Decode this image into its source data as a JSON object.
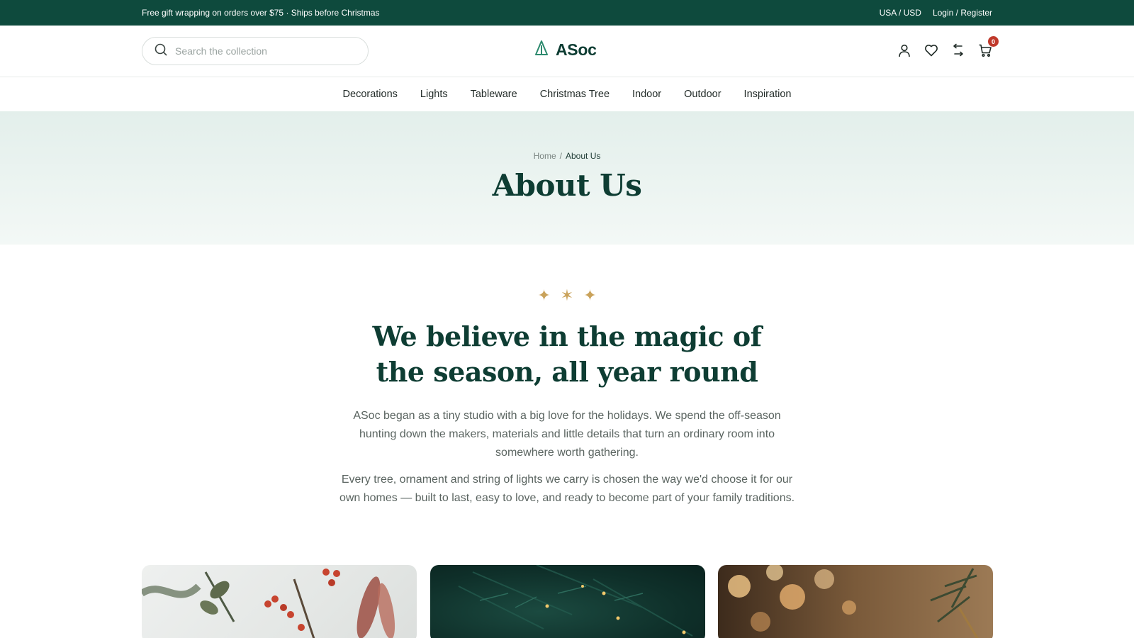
{
  "topbar": {
    "promo": "Free gift wrapping on orders over $75 · Ships before Christmas",
    "currency": "USA / USD",
    "account": "Login / Register",
    "bg_color": "#0e4a3d"
  },
  "header": {
    "search_placeholder": "Search the collection",
    "search_icon": "search-icon",
    "logo_text": "ASoc",
    "logo_icon": "tree-icon",
    "icons": [
      "user-icon",
      "heart-icon",
      "compare-icon",
      "cart-icon"
    ],
    "cart_count": "0"
  },
  "nav": {
    "items": [
      "Decorations",
      "Lights",
      "Tableware",
      "Christmas Tree",
      "Indoor",
      "Outdoor",
      "Inspiration"
    ]
  },
  "page": {
    "breadcrumb_home": "Home",
    "breadcrumb_sep": "/",
    "breadcrumb_current": "About Us",
    "title": "About Us"
  },
  "story": {
    "headline_line1": "We believe in the magic of",
    "headline_line2": "the season, all year round",
    "paragraph1": "ASoc began as a tiny studio with a big love for the holidays. We spend the off-season hunting down the makers, materials and little details that turn an ordinary room into somewhere worth gathering.",
    "paragraph2": "Every tree, ornament and string of lights we carry is chosen the way we'd choose it for our own homes — built to last, easy to love, and ready to become part of your family traditions.",
    "accent_color": "#c9a25a"
  },
  "colors": {
    "brand": "#0e3d33",
    "badge": "#c0392b",
    "text_muted": "#5a6460"
  }
}
